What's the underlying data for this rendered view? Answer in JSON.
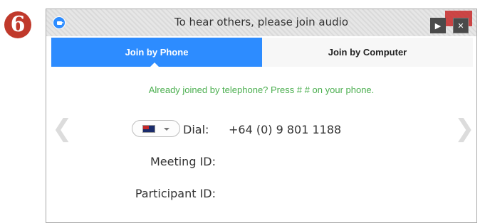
{
  "step": {
    "number": "6"
  },
  "window": {
    "title": "To hear others, please join audio"
  },
  "tabs": [
    {
      "label": "Join by Phone",
      "active": true
    },
    {
      "label": "Join by Computer",
      "active": false
    }
  ],
  "notice": "Already joined by telephone? Press #   # on your phone.",
  "country_select": {
    "flag": "new-zealand-flag",
    "value": ""
  },
  "dial": {
    "label": "Dial:",
    "number": "+64 (0) 9 801 1188"
  },
  "meeting_id": {
    "label": "Meeting ID:",
    "value": ""
  },
  "participant_id": {
    "label": "Participant ID:",
    "value": ""
  },
  "colors": {
    "accent": "#2d8cff",
    "notice": "#4caf50",
    "badge": "#c0392b",
    "close_hover": "#c62828"
  },
  "icons": {
    "app": "zoom-camera-icon",
    "left_nav": "chevron-left-icon",
    "right_nav": "chevron-right-icon",
    "play": "play-icon",
    "close": "close-icon"
  }
}
